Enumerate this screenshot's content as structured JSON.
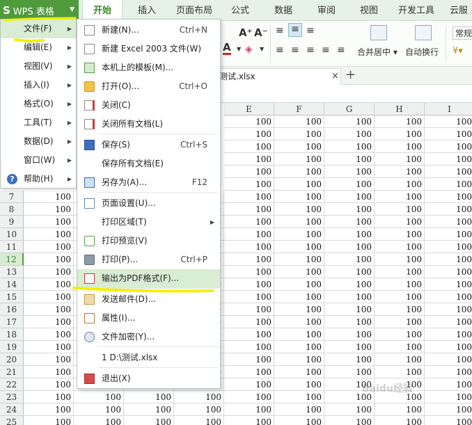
{
  "app": {
    "title": "WPS 表格",
    "logo": "S"
  },
  "tabs": [
    "开始",
    "插入",
    "页面布局",
    "公式",
    "数据",
    "审阅",
    "视图",
    "开发工具",
    "云服务"
  ],
  "ribbon": {
    "merge_label": "合并居中",
    "wrap_label": "自动换行",
    "format_label": "常规",
    "font_grow": "A⁺",
    "font_shrink": "A⁻",
    "font_color": "A"
  },
  "doc_tab": {
    "name": "测试.xlsx",
    "close": "×",
    "new": "+"
  },
  "app_menu": [
    {
      "label": "文件(F)",
      "submenu": true
    },
    {
      "label": "编辑(E)",
      "submenu": true
    },
    {
      "label": "视图(V)",
      "submenu": true
    },
    {
      "label": "插入(I)",
      "submenu": true
    },
    {
      "label": "格式(O)",
      "submenu": true
    },
    {
      "label": "工具(T)",
      "submenu": true
    },
    {
      "label": "数据(D)",
      "submenu": true
    },
    {
      "label": "窗口(W)",
      "submenu": true
    },
    {
      "label": "帮助(H)",
      "submenu": true
    }
  ],
  "file_menu": [
    {
      "label": "新建(N)...",
      "shortcut": "Ctrl+N",
      "icon": "new-file-icon"
    },
    {
      "label": "新建 Excel 2003 文件(W)",
      "shortcut": "",
      "icon": "new-file-icon"
    },
    {
      "label": "本机上的模板(M)...",
      "shortcut": "",
      "icon": "template-icon"
    },
    {
      "label": "打开(O)...",
      "shortcut": "Ctrl+O",
      "icon": "folder-icon"
    },
    {
      "label": "关闭(C)",
      "shortcut": "",
      "icon": "close-file-icon"
    },
    {
      "label": "关闭所有文档(L)",
      "shortcut": "",
      "icon": "close-all-icon"
    },
    {
      "label": "保存(S)",
      "shortcut": "Ctrl+S",
      "icon": "save-icon"
    },
    {
      "label": "保存所有文档(E)",
      "shortcut": "",
      "icon": ""
    },
    {
      "label": "另存为(A)...",
      "shortcut": "F12",
      "icon": "save-as-icon"
    },
    {
      "label": "页面设置(U)...",
      "shortcut": "",
      "icon": "page-setup-icon"
    },
    {
      "label": "打印区域(T)",
      "shortcut": "",
      "icon": "",
      "submenu": true
    },
    {
      "label": "打印预览(V)",
      "shortcut": "",
      "icon": "print-preview-icon"
    },
    {
      "label": "打印(P)...",
      "shortcut": "Ctrl+P",
      "icon": "printer-icon"
    },
    {
      "label": "输出为PDF格式(F)...",
      "shortcut": "",
      "icon": "pdf-icon"
    },
    {
      "label": "发送邮件(D)...",
      "shortcut": "",
      "icon": "mail-icon"
    },
    {
      "label": "属性(I)...",
      "shortcut": "",
      "icon": "properties-icon"
    },
    {
      "label": "文件加密(Y)...",
      "shortcut": "",
      "icon": "encrypt-icon"
    },
    {
      "label": "1 D:\\测试.xlsx",
      "shortcut": "",
      "icon": ""
    },
    {
      "label": "退出(X)",
      "shortcut": "",
      "icon": "exit-icon"
    }
  ],
  "grid": {
    "columns": [
      "E",
      "F",
      "G",
      "H",
      "I"
    ],
    "rows": [
      "7",
      "8",
      "9",
      "10",
      "11",
      "12",
      "13",
      "14",
      "15",
      "16",
      "17",
      "18",
      "19",
      "20",
      "21",
      "22",
      "23",
      "24",
      "25"
    ],
    "selected_row": "12",
    "cell_value": "100"
  },
  "colors": {
    "brand": "#4f9a3c",
    "highlight": "#d9ecd4",
    "marker": "#f5f000"
  },
  "watermark": "Baidu经验"
}
